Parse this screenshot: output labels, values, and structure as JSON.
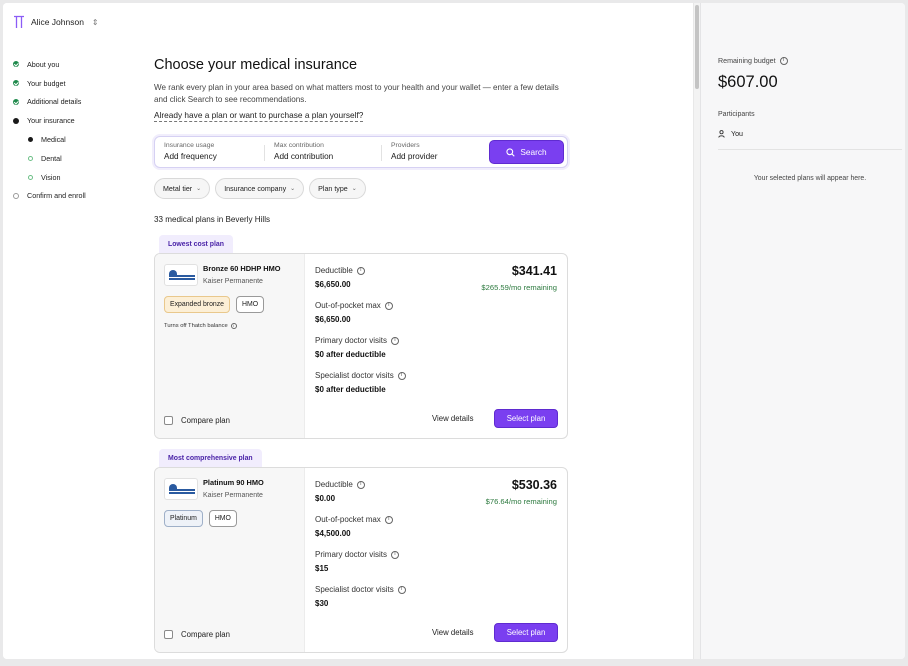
{
  "user": {
    "name": "Alice Johnson"
  },
  "sidebar": {
    "items": [
      {
        "label": "About you",
        "state": "done"
      },
      {
        "label": "Your budget",
        "state": "done"
      },
      {
        "label": "Additional details",
        "state": "done"
      },
      {
        "label": "Your insurance",
        "state": "current"
      },
      {
        "label": "Medical",
        "state": "current-sub"
      },
      {
        "label": "Dental",
        "state": "todo-sub"
      },
      {
        "label": "Vision",
        "state": "todo-sub"
      },
      {
        "label": "Confirm and enroll",
        "state": "todo"
      }
    ]
  },
  "main": {
    "title": "Choose your medical insurance",
    "description": "We rank every plan in your area based on what matters most to your health and your wallet — enter a few details and click Search to see recommendations.",
    "own_plan_link": "Already have a plan or want to purchase a plan yourself?",
    "search": {
      "fields": [
        {
          "label": "Insurance usage",
          "value": "Add frequency"
        },
        {
          "label": "Max contribution",
          "value": "Add contribution"
        },
        {
          "label": "Providers",
          "value": "Add provider"
        }
      ],
      "button_label": "Search"
    },
    "filters": [
      "Metal tier",
      "Insurance company",
      "Plan type"
    ],
    "results_count": "33 medical plans in Beverly Hills",
    "plans": [
      {
        "tag": "Lowest cost plan",
        "name": "Bronze 60 HDHP HMO",
        "carrier": "Kaiser Permanente",
        "logo_text": "KAISER PERMANENTE",
        "badges": [
          "Expanded bronze",
          "HMO"
        ],
        "note": "Turns off Thatch balance",
        "deductible_label": "Deductible",
        "deductible": "$6,650.00",
        "oop_label": "Out-of-pocket max",
        "oop": "$6,650.00",
        "primary_label": "Primary doctor visits",
        "primary": "$0 after deductible",
        "specialist_label": "Specialist doctor visits",
        "specialist": "$0 after deductible",
        "price": "$341.41",
        "remaining": "$265.59/mo remaining",
        "compare_label": "Compare plan",
        "view_label": "View details",
        "select_label": "Select plan"
      },
      {
        "tag": "Most comprehensive plan",
        "name": "Platinum 90 HMO",
        "carrier": "Kaiser Permanente",
        "logo_text": "KAISER PERMANENTE",
        "badges": [
          "Platinum",
          "HMO"
        ],
        "note": "",
        "deductible_label": "Deductible",
        "deductible": "$0.00",
        "oop_label": "Out-of-pocket max",
        "oop": "$4,500.00",
        "primary_label": "Primary doctor visits",
        "primary": "$15",
        "specialist_label": "Specialist doctor visits",
        "specialist": "$30",
        "price": "$530.36",
        "remaining": "$76.64/mo remaining",
        "compare_label": "Compare plan",
        "view_label": "View details",
        "select_label": "Select plan"
      }
    ]
  },
  "right_panel": {
    "budget_label": "Remaining budget",
    "budget_amount": "$607.00",
    "participants_label": "Participants",
    "participant": "You",
    "empty_message": "Your selected plans will appear here."
  },
  "colors": {
    "accent": "#7a3ff0",
    "success": "#1f8a4c",
    "remaining_green": "#2d7a3f",
    "tag_bg": "#f1edfd"
  }
}
